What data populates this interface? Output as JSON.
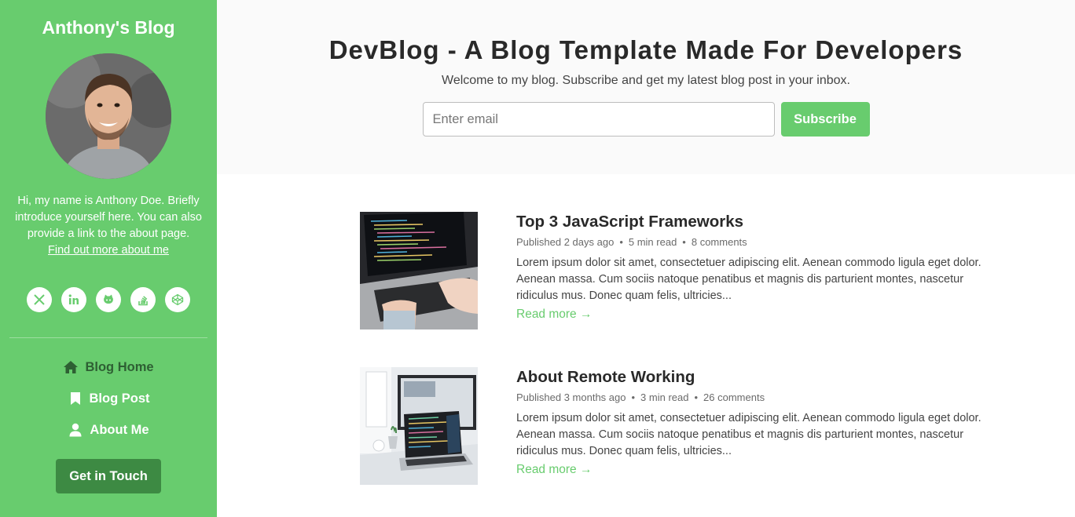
{
  "sidebar": {
    "site_title": "Anthony's Blog",
    "bio": "Hi, my name is Anthony Doe. Briefly introduce yourself here. You can also provide a link to the about page.",
    "bio_link": "Find out more about me",
    "social": [
      "x-twitter-icon",
      "linkedin-icon",
      "github-icon",
      "stack-overflow-icon",
      "codepen-icon"
    ],
    "nav": [
      {
        "label": "Blog Home",
        "icon": "home-icon",
        "active": true
      },
      {
        "label": "Blog Post",
        "icon": "bookmark-icon"
      },
      {
        "label": "About Me",
        "icon": "user-icon"
      }
    ],
    "cta": "Get in Touch"
  },
  "hero": {
    "title": "DevBlog - A Blog Template Made For Developers",
    "subtitle": "Welcome to my blog. Subscribe and get my latest blog post in your inbox.",
    "email_placeholder": "Enter email",
    "subscribe": "Subscribe"
  },
  "posts": [
    {
      "title": "Top 3 JavaScript Frameworks",
      "published": "Published 2 days ago",
      "read": "5 min read",
      "comments": "8 comments",
      "excerpt": "Lorem ipsum dolor sit amet, consectetuer adipiscing elit. Aenean commodo ligula eget dolor. Aenean massa. Cum sociis natoque penatibus et magnis dis parturient montes, nascetur ridiculus mus. Donec quam felis, ultricies...",
      "read_more": "Read more →"
    },
    {
      "title": "About Remote Working",
      "published": "Published 3 months ago",
      "read": "3 min read",
      "comments": "26 comments",
      "excerpt": "Lorem ipsum dolor sit amet, consectetuer adipiscing elit. Aenean commodo ligula eget dolor. Aenean massa. Cum sociis natoque penatibus et magnis dis parturient montes, nascetur ridiculus mus. Donec quam felis, ultricies...",
      "read_more": "Read more →"
    }
  ],
  "colors": {
    "accent": "#68cc6e",
    "accent_dark": "#3d8a43",
    "hero_bg": "#fafafa"
  }
}
